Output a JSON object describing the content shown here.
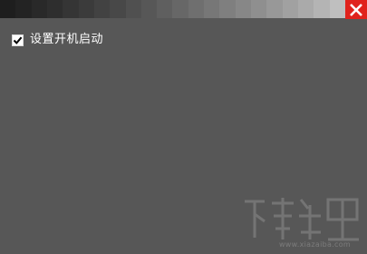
{
  "titlebar": {
    "gradient_tiles": [
      "#1e1e1e",
      "#232323",
      "#292929",
      "#2e2e2e",
      "#353535",
      "#3b3b3b",
      "#424242",
      "#484848",
      "#505050",
      "#575757",
      "#5f5f5f",
      "#676767",
      "#6f6f6f",
      "#777777",
      "#7f7f7f",
      "#878787",
      "#8f8f8f",
      "#989898",
      "#a1a1a1",
      "#aaaaaa",
      "#b4b4b4",
      "#bfbfbf"
    ],
    "close_icon": "close-icon",
    "close_color": "#e0221c"
  },
  "settings": {
    "startup_checkbox_checked": true,
    "startup_label": "设置开机启动"
  },
  "watermark": {
    "url": "www.xiazaiba.com"
  },
  "colors": {
    "background": "#575757",
    "text": "#ffffff"
  }
}
